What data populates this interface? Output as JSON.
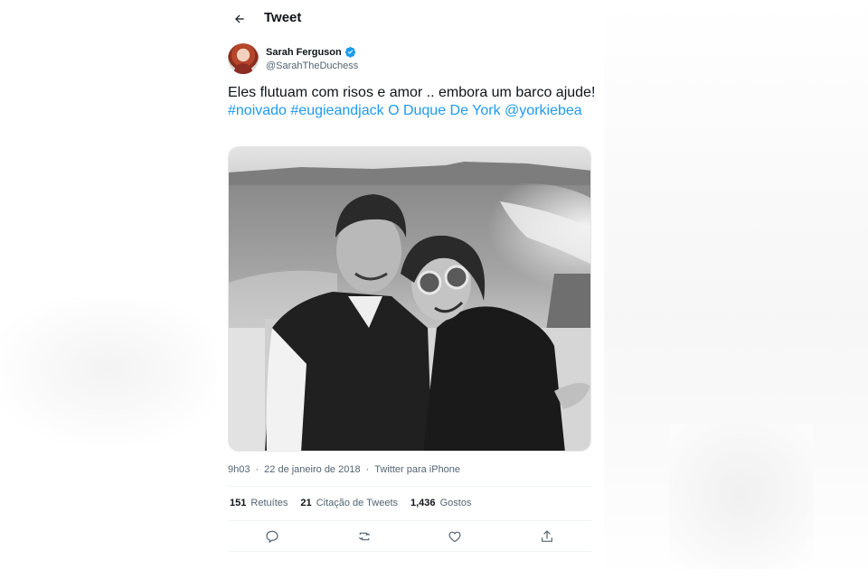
{
  "header": {
    "title": "Tweet",
    "back_icon": "arrow-left-icon"
  },
  "author": {
    "name": "Sarah Ferguson",
    "handle": "@SarahTheDuchess",
    "verified_icon": "verified-badge-icon",
    "verified_color": "#1d9bf0"
  },
  "tweet": {
    "text_plain": "Eles flutuam com risos e amor .. embora um barco ajude! ",
    "hashtag_1": "#noivado",
    "hashtag_2": "#eugieandjack",
    "mention_text": "O Duque De York",
    "mention_2": "@yorkiebea",
    "link_color": "#1d9bf0"
  },
  "meta": {
    "time": "9h03",
    "date": "22 de janeiro de 2018",
    "separator": "·",
    "source": "Twitter para iPhone"
  },
  "stats": {
    "retweets_count": "151",
    "retweets_label": "Retuítes",
    "quotes_count": "21",
    "quotes_label": "Citação de Tweets",
    "likes_count": "1,436",
    "likes_label": "Gostos"
  },
  "actions": {
    "reply_icon": "reply-icon",
    "retweet_icon": "retweet-icon",
    "like_icon": "heart-icon",
    "share_icon": "share-icon"
  }
}
